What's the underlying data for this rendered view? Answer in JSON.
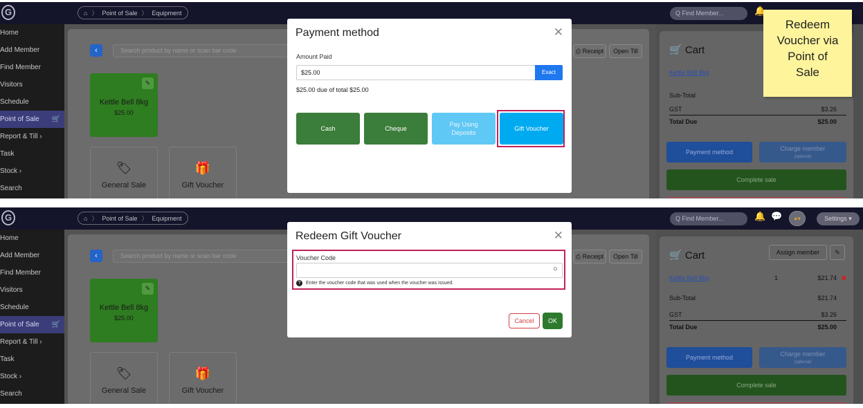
{
  "topbar": {
    "logo": "G",
    "home_icon": "⌂",
    "breadcrumb": [
      "Point of Sale",
      "Equipment"
    ],
    "find_member": "Q Find Member...",
    "settings": "Settings ▾"
  },
  "sidebar": {
    "items": [
      "Home",
      "Add Member",
      "Find Member",
      "Visitors",
      "Schedule",
      "Point of Sale",
      "Report & Till ›",
      "Task",
      "Stock ›",
      "Search"
    ],
    "active_index": 5
  },
  "pos": {
    "search_placeholder": "Search product by name or scan bar code",
    "receipt_button": "⎙ Receipt",
    "open_till_button": "Open Till",
    "product": {
      "name": "Kettle Bell 8kg",
      "price": "$25.00"
    },
    "tiles": [
      {
        "label": "General Sale",
        "icon": "tags-icon"
      },
      {
        "label": "Gift Voucher",
        "icon": "gift-icon"
      }
    ]
  },
  "cart": {
    "title": "Cart",
    "assign_member": "Assign member",
    "item": {
      "name": "Kettle Bell 8kg",
      "qty": "1",
      "price": "$21.74"
    },
    "subtotal_label": "Sub-Total",
    "subtotal": "$21.74",
    "gst_label": "GST",
    "gst": "$3.26",
    "total_label": "Total Due",
    "total": "$25.00",
    "payment_method": "Payment method",
    "charge_member": "Charge member",
    "charge_member_sub": "(optional)",
    "complete_sale": "Complete sale"
  },
  "payment_modal": {
    "title": "Payment method",
    "amount_label": "Amount Paid",
    "amount_value": "$25.00",
    "exact": "Exact",
    "due_text": "$25.00 due of total $25.00",
    "buttons": [
      {
        "label": "Cash",
        "color": "#3b7d3b"
      },
      {
        "label": "Cheque",
        "color": "#3b7d3b"
      },
      {
        "label": "Pay Using Deposits",
        "color": "#60c8f4"
      },
      {
        "label": "Gift Voucher",
        "color": "#00aaf0"
      }
    ]
  },
  "voucher_modal": {
    "title": "Redeem Gift Voucher",
    "code_label": "Voucher Code",
    "code_value": "",
    "hint": "Enter the voucher code that was used when the voucher was issued.",
    "cancel": "Cancel",
    "ok": "OK"
  },
  "sticky_note": {
    "lines": [
      "Redeem",
      "Voucher via",
      "Point of",
      "Sale"
    ]
  },
  "colors": {
    "highlight": "#c0205a",
    "sidebar_active": "#3b3d7a",
    "primary": "#1e78ee"
  }
}
